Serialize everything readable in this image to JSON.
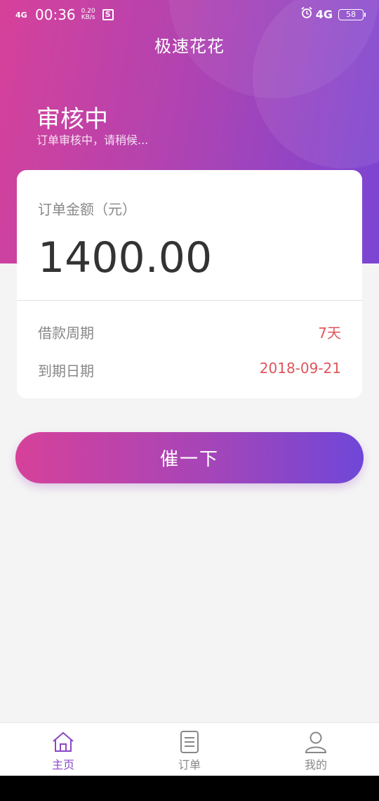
{
  "status_bar": {
    "signal": "4G",
    "time": "00:36",
    "speed_value": "0.20",
    "speed_unit": "KB/s",
    "s_icon": "S",
    "network": "4G",
    "battery": "58"
  },
  "header": {
    "app_title": "极速花花",
    "status_title": "审核中",
    "status_subtitle": "订单审核中，请稍候..."
  },
  "order_card": {
    "amount_label": "订单金额（元）",
    "amount_value": "1400.00",
    "period_label": "借款周期",
    "period_value": "7天",
    "due_label": "到期日期",
    "due_value": "2018-09-21"
  },
  "actions": {
    "urge_label": "催一下"
  },
  "tabbar": {
    "items": [
      {
        "label": "主页",
        "icon": "home-icon",
        "active": true
      },
      {
        "label": "订单",
        "icon": "document-icon",
        "active": false
      },
      {
        "label": "我的",
        "icon": "user-icon",
        "active": false
      }
    ]
  },
  "colors": {
    "gradient_start": "#d6419a",
    "gradient_end": "#6f47d8",
    "accent_red": "#e0555a",
    "active_tab": "#8a48c8"
  }
}
